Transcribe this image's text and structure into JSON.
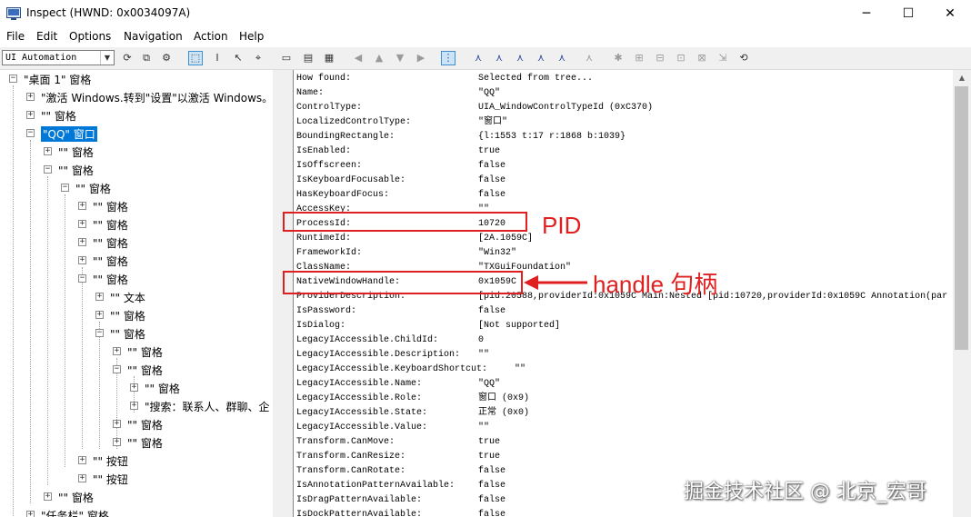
{
  "window": {
    "title": "Inspect  (HWND: 0x0034097A)",
    "minimize": "─",
    "maximize": "☐",
    "close": "✕"
  },
  "menu": [
    "File",
    "Edit",
    "Options",
    "Navigation",
    "Action",
    "Help"
  ],
  "toolbar": {
    "mode": "UI Automation"
  },
  "tree": [
    {
      "label": "\"桌面 1\" 窗格",
      "expander": "−"
    },
    {
      "label": "\"激活 Windows.转到\"设置\"以激活 Windows。",
      "expander": "+"
    },
    {
      "label": "\"\" 窗格",
      "expander": "+"
    },
    {
      "label": "\"QQ\" 窗口",
      "expander": "−",
      "selected": true
    },
    {
      "label": "\"\" 窗格",
      "expander": "+"
    },
    {
      "label": "\"\" 窗格",
      "expander": "−"
    },
    {
      "label": "\"\" 窗格",
      "expander": "−"
    },
    {
      "label": "\"\" 窗格",
      "expander": "+"
    },
    {
      "label": "\"\" 窗格",
      "expander": "+"
    },
    {
      "label": "\"\" 窗格",
      "expander": "+"
    },
    {
      "label": "\"\" 窗格",
      "expander": "+"
    },
    {
      "label": "\"\" 窗格",
      "expander": "−"
    },
    {
      "label": "\"\" 文本",
      "expander": "+"
    },
    {
      "label": "\"\" 窗格",
      "expander": "+"
    },
    {
      "label": "\"\" 窗格",
      "expander": "−"
    },
    {
      "label": "\"\" 窗格",
      "expander": "+"
    },
    {
      "label": "\"\" 窗格",
      "expander": "−"
    },
    {
      "label": "\"\" 窗格",
      "expander": "+"
    },
    {
      "label": "\"搜索：联系人、群聊、企",
      "expander": "+"
    },
    {
      "label": "\"\" 窗格",
      "expander": "+"
    },
    {
      "label": "\"\" 窗格",
      "expander": "+"
    },
    {
      "label": "\"\" 按钮",
      "expander": "+"
    },
    {
      "label": "\"\" 按钮",
      "expander": "+"
    },
    {
      "label": "\"\" 窗格",
      "expander": "+"
    },
    {
      "label": "\"任务栏\" 窗格",
      "expander": "+"
    }
  ],
  "properties": [
    {
      "name": "How found:",
      "value": "Selected from tree..."
    },
    {
      "name": "Name:",
      "value": "\"QQ\""
    },
    {
      "name": "ControlType:",
      "value": "UIA_WindowControlTypeId (0xC370)"
    },
    {
      "name": "LocalizedControlType:",
      "value": "\"窗口\""
    },
    {
      "name": "BoundingRectangle:",
      "value": "{l:1553 t:17 r:1868 b:1039}"
    },
    {
      "name": "IsEnabled:",
      "value": "true"
    },
    {
      "name": "IsOffscreen:",
      "value": "false"
    },
    {
      "name": "IsKeyboardFocusable:",
      "value": "false"
    },
    {
      "name": "HasKeyboardFocus:",
      "value": "false"
    },
    {
      "name": "AccessKey:",
      "value": "\"\""
    },
    {
      "name": "ProcessId:",
      "value": "10720"
    },
    {
      "name": "RuntimeId:",
      "value": "[2A.1059C]"
    },
    {
      "name": "FrameworkId:",
      "value": "\"Win32\""
    },
    {
      "name": "ClassName:",
      "value": "\"TXGuiFoundation\""
    },
    {
      "name": "NativeWindowHandle:",
      "value": "0x1059C"
    },
    {
      "name": "ProviderDescription:",
      "value": "[pid:20588,providerId:0x1059C Main:Nested [pid:10720,providerId:0x1059C Annotation(par"
    },
    {
      "name": "IsPassword:",
      "value": "false"
    },
    {
      "name": "IsDialog:",
      "value": "[Not supported]"
    },
    {
      "name": "LegacyIAccessible.ChildId:",
      "value": "0"
    },
    {
      "name": "LegacyIAccessible.Description:",
      "value": "\"\""
    },
    {
      "name": "LegacyIAccessible.KeyboardShortcut:",
      "value": "\"\""
    },
    {
      "name": "LegacyIAccessible.Name:",
      "value": "\"QQ\""
    },
    {
      "name": "LegacyIAccessible.Role:",
      "value": "窗口 (0x9)"
    },
    {
      "name": "LegacyIAccessible.State:",
      "value": "正常 (0x0)"
    },
    {
      "name": "LegacyIAccessible.Value:",
      "value": "\"\""
    },
    {
      "name": "Transform.CanMove:",
      "value": "true"
    },
    {
      "name": "Transform.CanResize:",
      "value": "true"
    },
    {
      "name": "Transform.CanRotate:",
      "value": "false"
    },
    {
      "name": "IsAnnotationPatternAvailable:",
      "value": "false"
    },
    {
      "name": "IsDragPatternAvailable:",
      "value": "false"
    },
    {
      "name": "IsDockPatternAvailable:",
      "value": "false"
    }
  ],
  "annotations": {
    "pid_label": "PID",
    "handle_label": "handle 句柄",
    "color": "#e02020"
  },
  "watermark": "掘金技术社区 @ 北京_宏哥"
}
